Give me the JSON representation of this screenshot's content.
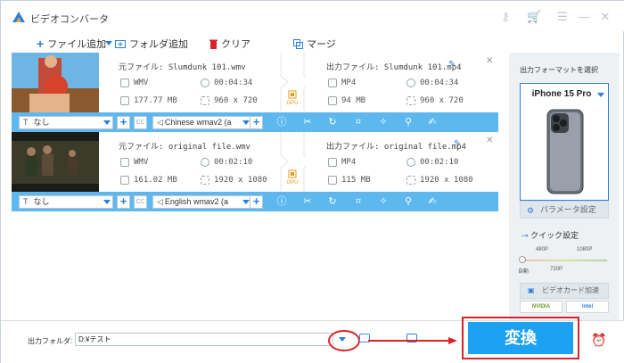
{
  "window": {
    "title": "ビデオコンバータ"
  },
  "titlebar_icons": [
    "key-icon",
    "cart-icon",
    "menu-icon",
    "minimize-icon",
    "close-icon"
  ],
  "toolbar": {
    "add_file": "ファイル追加",
    "add_folder": "フォルダ追加",
    "clear": "クリア",
    "merge": "マージ"
  },
  "files": [
    {
      "source_name": "元ファイル: Slumdunk 101.wmv",
      "source_format": "WMV",
      "source_duration": "00:04:34",
      "source_size": "177.77 MB",
      "source_resolution": "960 x 720",
      "output_name": "出力ファイル: Slumdunk 101.mp4",
      "output_format": "MP4",
      "output_duration": "00:04:34",
      "output_size": "94 MB",
      "output_resolution": "960 x 720",
      "gpu_label": "GPU",
      "subtitle": "なし",
      "audio": "Chinese wmav2 (a"
    },
    {
      "source_name": "元ファイル: original file.wmv",
      "source_format": "WMV",
      "source_duration": "00:02:10",
      "source_size": "161.02 MB",
      "source_resolution": "1920 x 1080",
      "output_name": "出力ファイル: original file.mp4",
      "output_format": "MP4",
      "output_duration": "00:02:10",
      "output_size": "115 MB",
      "output_resolution": "1920 x 1080",
      "gpu_label": "GPU",
      "subtitle": "なし",
      "audio": "English wmav2 (a"
    }
  ],
  "sidepanel": {
    "title": "出力フォーマットを選択",
    "format": "iPhone 15 Pro",
    "param_button": "パラメータ設定",
    "quick_label": "クイック設定",
    "ticks_top": [
      "480P",
      "1080P"
    ],
    "ticks_bottom": [
      "自動",
      "720P"
    ],
    "gpu_accel": "ビデオカード加速",
    "vendors": [
      "NVIDIA",
      "intel"
    ]
  },
  "footer": {
    "output_folder_label": "出力フォルダ:",
    "output_folder_value": "D:¥テスト",
    "convert_label": "変換"
  },
  "colors": {
    "accent": "#1da1f2",
    "bar": "#5db8ef",
    "highlight": "#d8232a"
  }
}
